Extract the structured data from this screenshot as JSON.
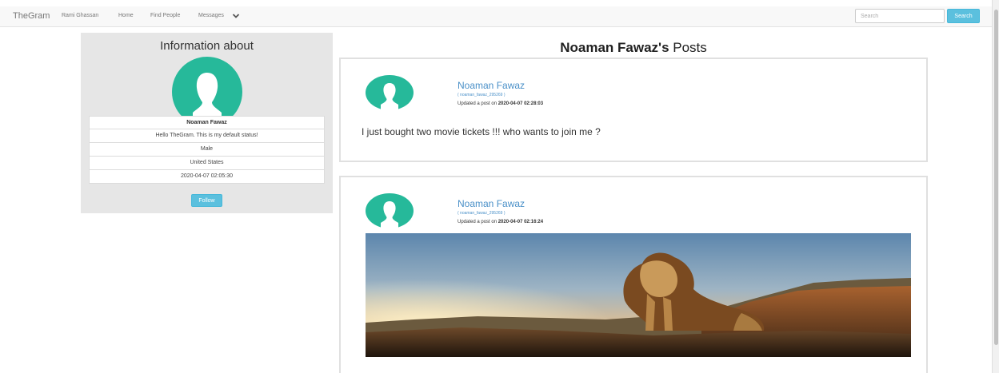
{
  "nav": {
    "brand": "TheGram",
    "links": [
      "Rami Ghassan",
      "Home",
      "Find People",
      "Messages"
    ],
    "search_placeholder": "Search",
    "search_button": "Search"
  },
  "profile": {
    "title": "Information about",
    "name": "Noaman Fawaz",
    "status": "Hello TheGram. This is my default status!",
    "gender": "Male",
    "country": "United States",
    "joined": "2020-04-07 02:05:30",
    "follow_label": "Follow"
  },
  "posts_heading": {
    "name": "Noaman Fawaz's",
    "suffix": " Posts"
  },
  "posts": [
    {
      "author": "Noaman Fawaz",
      "handle": "( noaman_fawaz_295269 )",
      "updated_prefix": "Updated a post on ",
      "updated_at": "2020-04-07 02:28:03",
      "text": "I just bought two movie tickets !!! who wants to join me ?"
    },
    {
      "author": "Noaman Fawaz",
      "handle": "( noaman_fawaz_295269 )",
      "updated_prefix": "Updated a post on ",
      "updated_at": "2020-04-07 02:16:24",
      "image": "lion-sunset-image"
    }
  ],
  "colors": {
    "accent": "#5bc0de",
    "avatar": "#26b99a",
    "link": "#4a90c8",
    "panel": "#e6e6e6"
  }
}
